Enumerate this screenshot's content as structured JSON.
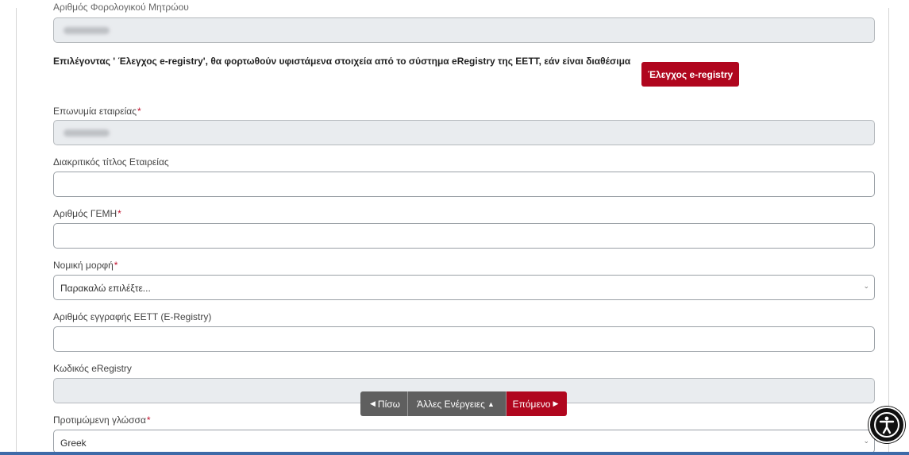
{
  "form": {
    "tax_id_label": "Αριθμός Φορολογικού Μητρώου",
    "info_text": "Επιλέγοντας ' Έλεγχος e-registry', θα φορτωθούν υφιστάμενα στοιχεία από το σύστημα eRegistry της ΕΕΤΤ, εάν είναι διαθέσιμα",
    "check_button": "Έλεγχος e-registry",
    "company_name_label": "Επωνυμία εταιρείας",
    "distinctive_title_label": "Διακριτικός τίτλος Εταιρείας",
    "gemi_label": "Αριθμός ΓΕΜΗ",
    "legal_form_label": "Νομική μορφή",
    "legal_form_value": "Παρακαλώ επιλέξτε...",
    "eett_reg_label": "Αριθμός εγγραφής ΕΕΤΤ (E-Registry)",
    "ereg_code_label": "Κωδικός eRegistry",
    "language_label": "Προτιμώμενη γλώσσα",
    "language_value": "Greek",
    "required_mark": "*"
  },
  "toolbar": {
    "back": "Πίσω",
    "more": "Άλλες Ενέργειες",
    "next": "Επόμενο"
  },
  "icons": {
    "back": "triangle-left-icon",
    "more": "triangle-up-icon",
    "next": "triangle-right-icon",
    "accessibility": "accessibility-icon"
  },
  "colors": {
    "accent": "#b0061e",
    "toolbar": "#5f5f5f",
    "disabled_field": "#e9ecef"
  }
}
